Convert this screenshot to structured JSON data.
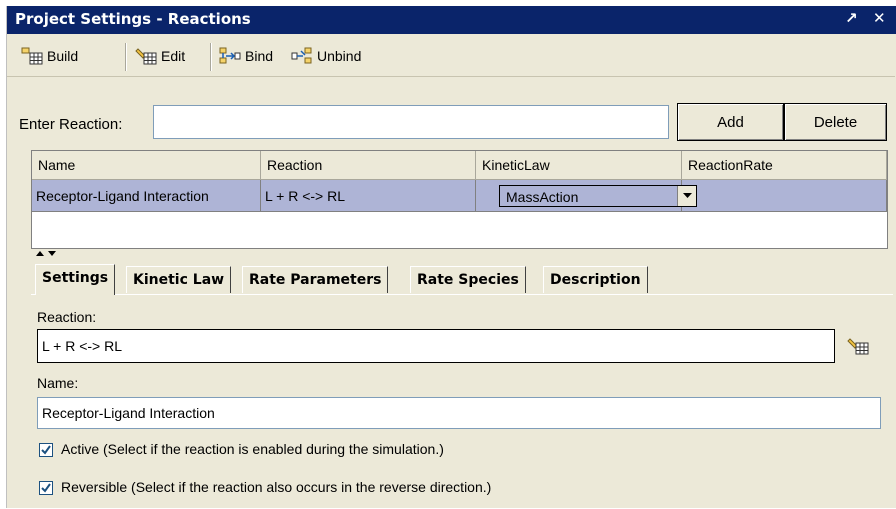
{
  "window": {
    "title": "Project Settings - Reactions",
    "undock_glyph": "↗",
    "close_glyph": "✕"
  },
  "toolbar": {
    "build_label": "Build",
    "edit_label": "Edit",
    "bind_label": "Bind",
    "unbind_label": "Unbind"
  },
  "enter_reaction": {
    "label": "Enter Reaction:",
    "value": "",
    "add_label": "Add",
    "delete_label": "Delete"
  },
  "table": {
    "columns": [
      "Name",
      "Reaction",
      "KineticLaw",
      "ReactionRate"
    ],
    "rows": [
      {
        "name": "Receptor-Ligand Interaction",
        "reaction": "L + R <-> RL",
        "kinetic_law": "MassAction",
        "reaction_rate": ""
      }
    ]
  },
  "tabs": [
    "Settings",
    "Kinetic Law",
    "Rate Parameters",
    "Rate Species",
    "Description"
  ],
  "settings": {
    "reaction_label": "Reaction:",
    "reaction_value": "L + R <-> RL",
    "name_label": "Name:",
    "name_value": "Receptor-Ligand Interaction",
    "active_label": "Active (Select if the reaction is enabled during the simulation.)",
    "active_checked": true,
    "reversible_label": "Reversible (Select if the reaction also occurs in the reverse direction.)",
    "reversible_checked": true
  },
  "colors": {
    "titlebar": "#0a246a",
    "selection_row": "#aeb4d6",
    "panel_bg": "#ece9d8"
  },
  "icons": {
    "build": "build-icon",
    "edit": "edit-pencil-icon",
    "bind": "bind-icon",
    "unbind": "unbind-icon",
    "reaction_editor": "edit-pencil-icon",
    "combo_dropdown": "chevron-down-icon",
    "splitter": "splitter-arrows-icon"
  }
}
